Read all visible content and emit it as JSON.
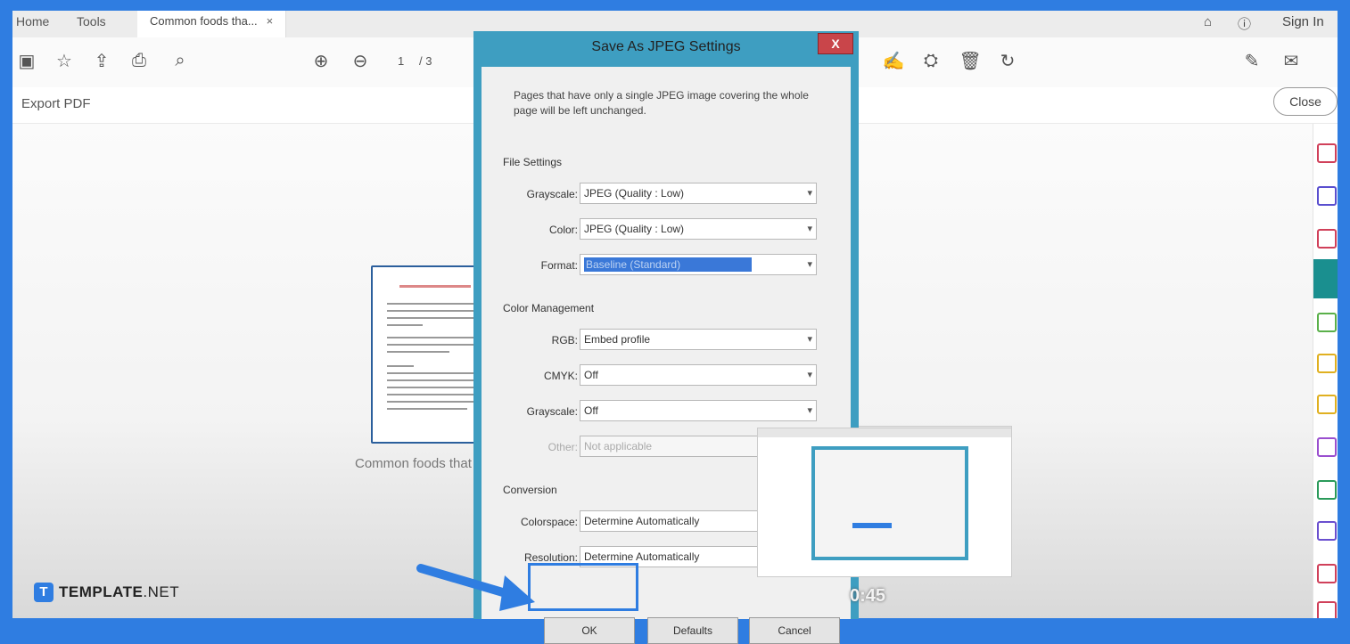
{
  "tabs": {
    "home": "Home",
    "tools": "Tools",
    "document": "Common foods tha...",
    "close_glyph": "×"
  },
  "topbar": {
    "sign_in": "Sign In"
  },
  "toolbar": {
    "page_current": "1",
    "page_total": "/ 3"
  },
  "export": {
    "title": "Export PDF",
    "close": "Close"
  },
  "document": {
    "thumbnail_caption": "Common foods that ca"
  },
  "dialog": {
    "title": "Save As JPEG Settings",
    "close_glyph": "X",
    "note": "Pages that have only a single JPEG image covering the whole page will be left unchanged.",
    "file_settings": {
      "heading": "File Settings",
      "grayscale_label": "Grayscale:",
      "grayscale_value": "JPEG (Quality : Low)",
      "color_label": "Color:",
      "color_value": "JPEG (Quality : Low)",
      "format_label": "Format:",
      "format_value": "Baseline (Standard)"
    },
    "color_management": {
      "heading": "Color Management",
      "rgb_label": "RGB:",
      "rgb_value": "Embed profile",
      "cmyk_label": "CMYK:",
      "cmyk_value": "Off",
      "grayscale_label": "Grayscale:",
      "grayscale_value": "Off",
      "other_label": "Other:",
      "other_value": "Not applicable"
    },
    "conversion": {
      "heading": "Conversion",
      "colorspace_label": "Colorspace:",
      "colorspace_value": "Determine Automatically",
      "resolution_label": "Resolution:",
      "resolution_value": "Determine Automatically"
    },
    "buttons": {
      "ok": "OK",
      "defaults": "Defaults",
      "cancel": "Cancel"
    }
  },
  "video": {
    "timecode": "0:45"
  },
  "watermark": {
    "letter": "T",
    "brand": "TEMPLATE",
    "suffix": ".NET"
  },
  "colors": {
    "frame": "#2f7de1",
    "dialog_border": "#3e9ec1",
    "close_red": "#c9454a",
    "selection": "#3a78d8"
  },
  "icons": [
    "save-icon",
    "bookmark-star-icon",
    "upload-cloud-icon",
    "print-icon",
    "zoom-icon",
    "page-up-icon",
    "page-down-icon",
    "sign-icon",
    "stamp-icon",
    "delete-icon",
    "rotate-icon",
    "pen-icon",
    "mail-icon",
    "help-icon",
    "notification-icon"
  ]
}
